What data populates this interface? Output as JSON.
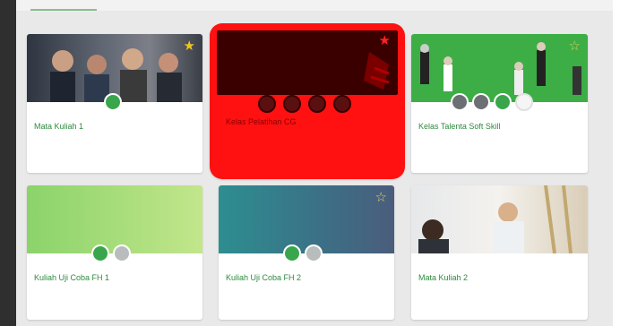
{
  "courses": [
    {
      "title": "Mata Kuliah 1",
      "starred": true,
      "star_color": "#f0c419",
      "banner": "people-group"
    },
    {
      "title": "Kelas Pelatihan CG",
      "starred": true,
      "star_color": "#ff2222",
      "banner": "dark-red",
      "selected": true,
      "highlight_color": "#ff1111"
    },
    {
      "title": "Kelas Talenta Soft Skill",
      "starred": false,
      "star_color": "#d8d060",
      "banner": "green-screen"
    },
    {
      "title": "Kuliah Uji Coba FH 1",
      "starred": false,
      "banner": "green-gradient"
    },
    {
      "title": "Kuliah Uji Coba FH 2",
      "starred": false,
      "star_color": "#e3d05a",
      "banner": "teal-gradient"
    },
    {
      "title": "Mata Kuliah 2",
      "starred": false,
      "banner": "office-photo"
    }
  ],
  "icons": [
    "star-icon",
    "group-icon",
    "user-avatar"
  ],
  "colors": {
    "accent": "#3aa64c",
    "title_green": "#2e8a3f",
    "selected_red": "#ff1111"
  }
}
